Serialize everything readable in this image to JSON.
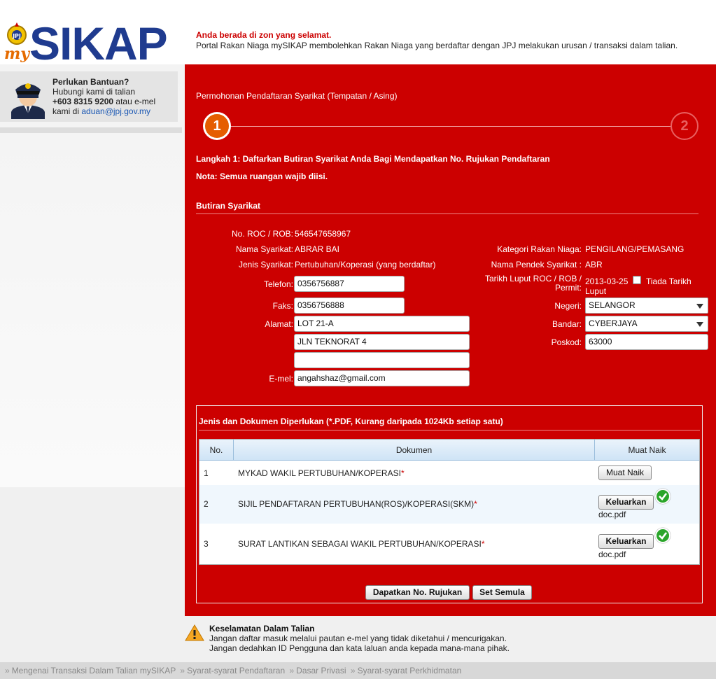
{
  "header": {
    "logo_prefix": "my",
    "logo_text": "SIKAP",
    "notice_title": "Anda berada di zon yang selamat.",
    "notice_text": "Portal Rakan Niaga mySIKAP membolehkan Rakan Niaga yang berdaftar dengan JPJ melakukan urusan / transaksi dalam talian."
  },
  "help": {
    "title": "Perlukan Bantuan?",
    "line1": "Hubungi kami di talian",
    "phone": "+603 8315 9200",
    "line2_suffix": " atau e-mel",
    "line3_prefix": "kami di ",
    "email": "aduan@jpj.gov.my"
  },
  "main": {
    "title": "Permohonan Pendaftaran Syarikat (Tempatan / Asing)",
    "steps": [
      "1",
      "2"
    ],
    "step_heading": "Langkah 1: Daftarkan Butiran Syarikat Anda Bagi Mendapatkan No. Rujukan Pendaftaran",
    "note": "Nota: Semua ruangan wajib diisi.",
    "section_title": "Butiran Syarikat"
  },
  "form": {
    "roc_label": "No. ROC / ROB:",
    "roc_value": "546547658967",
    "name_label": "Nama Syarikat:",
    "name_value": "ABRAR BAI",
    "type_label": "Jenis Syarikat:",
    "type_value": "Pertubuhan/Koperasi (yang berdaftar)",
    "phone_label": "Telefon:",
    "phone_value": "0356756887",
    "fax_label": "Faks:",
    "fax_value": "0356756888",
    "address_label": "Alamat:",
    "address1": "LOT 21-A",
    "address2": "JLN TEKNORAT 4",
    "address3": "",
    "email_label": "E-mel:",
    "email_value": "angahshaz@gmail.com",
    "category_label": "Kategori Rakan Niaga:",
    "category_value": "PENGILANG/PEMASANG",
    "short_name_label": "Nama Pendek Syarikat :",
    "short_name_value": "ABR",
    "expiry_label_1": "Tarikh Luput ROC / ROB /",
    "expiry_label_2": "Permit:",
    "expiry_value": "2013-03-25",
    "no_expiry_label_1": "Tiada Tarikh",
    "no_expiry_label_2": "Luput",
    "state_label": "Negeri:",
    "state_value": "SELANGOR",
    "city_label": "Bandar:",
    "city_value": "CYBERJAYA",
    "postcode_label": "Poskod:",
    "postcode_value": "63000"
  },
  "documents": {
    "title": "Jenis dan Dokumen Diperlukan (*.PDF, Kurang daripada 1024Kb setiap satu)",
    "columns": [
      "No.",
      "Dokumen",
      "Muat Naik"
    ],
    "rows": [
      {
        "no": "1",
        "name": "MYKAD WAKIL PERTUBUHAN/KOPERASI",
        "button": "Muat Naik",
        "file": ""
      },
      {
        "no": "2",
        "name": "SIJIL PENDAFTARAN PERTUBUHAN(ROS)/KOPERASI(SKM)",
        "button": "Keluarkan",
        "file": "doc.pdf"
      },
      {
        "no": "3",
        "name": "SURAT LANTIKAN SEBAGAI WAKIL PERTUBUHAN/KOPERASI",
        "button": "Keluarkan",
        "file": "doc.pdf"
      }
    ],
    "required_mark": "*"
  },
  "actions": {
    "get_reference": "Dapatkan No. Rujukan",
    "reset": "Set Semula"
  },
  "security": {
    "title": "Keselamatan Dalam Talian",
    "line1": "Jangan daftar masuk melalui pautan e-mel yang tidak diketahui / mencurigakan.",
    "line2": "Jangan dedahkan ID Pengguna dan kata laluan anda kepada mana-mana pihak."
  },
  "footer": {
    "separator": "»",
    "links": [
      "Mengenai Transaksi Dalam Talian mySIKAP",
      "Syarat-syarat Pendaftaran",
      "Dasar Privasi",
      "Syarat-syarat Perkhidmatan"
    ]
  },
  "colors": {
    "panel_red": "#cc0000",
    "logo_blue": "#1f3b8f",
    "logo_orange": "#e56b00",
    "step_active": "#e55d00",
    "success_green": "#2aa52a"
  }
}
